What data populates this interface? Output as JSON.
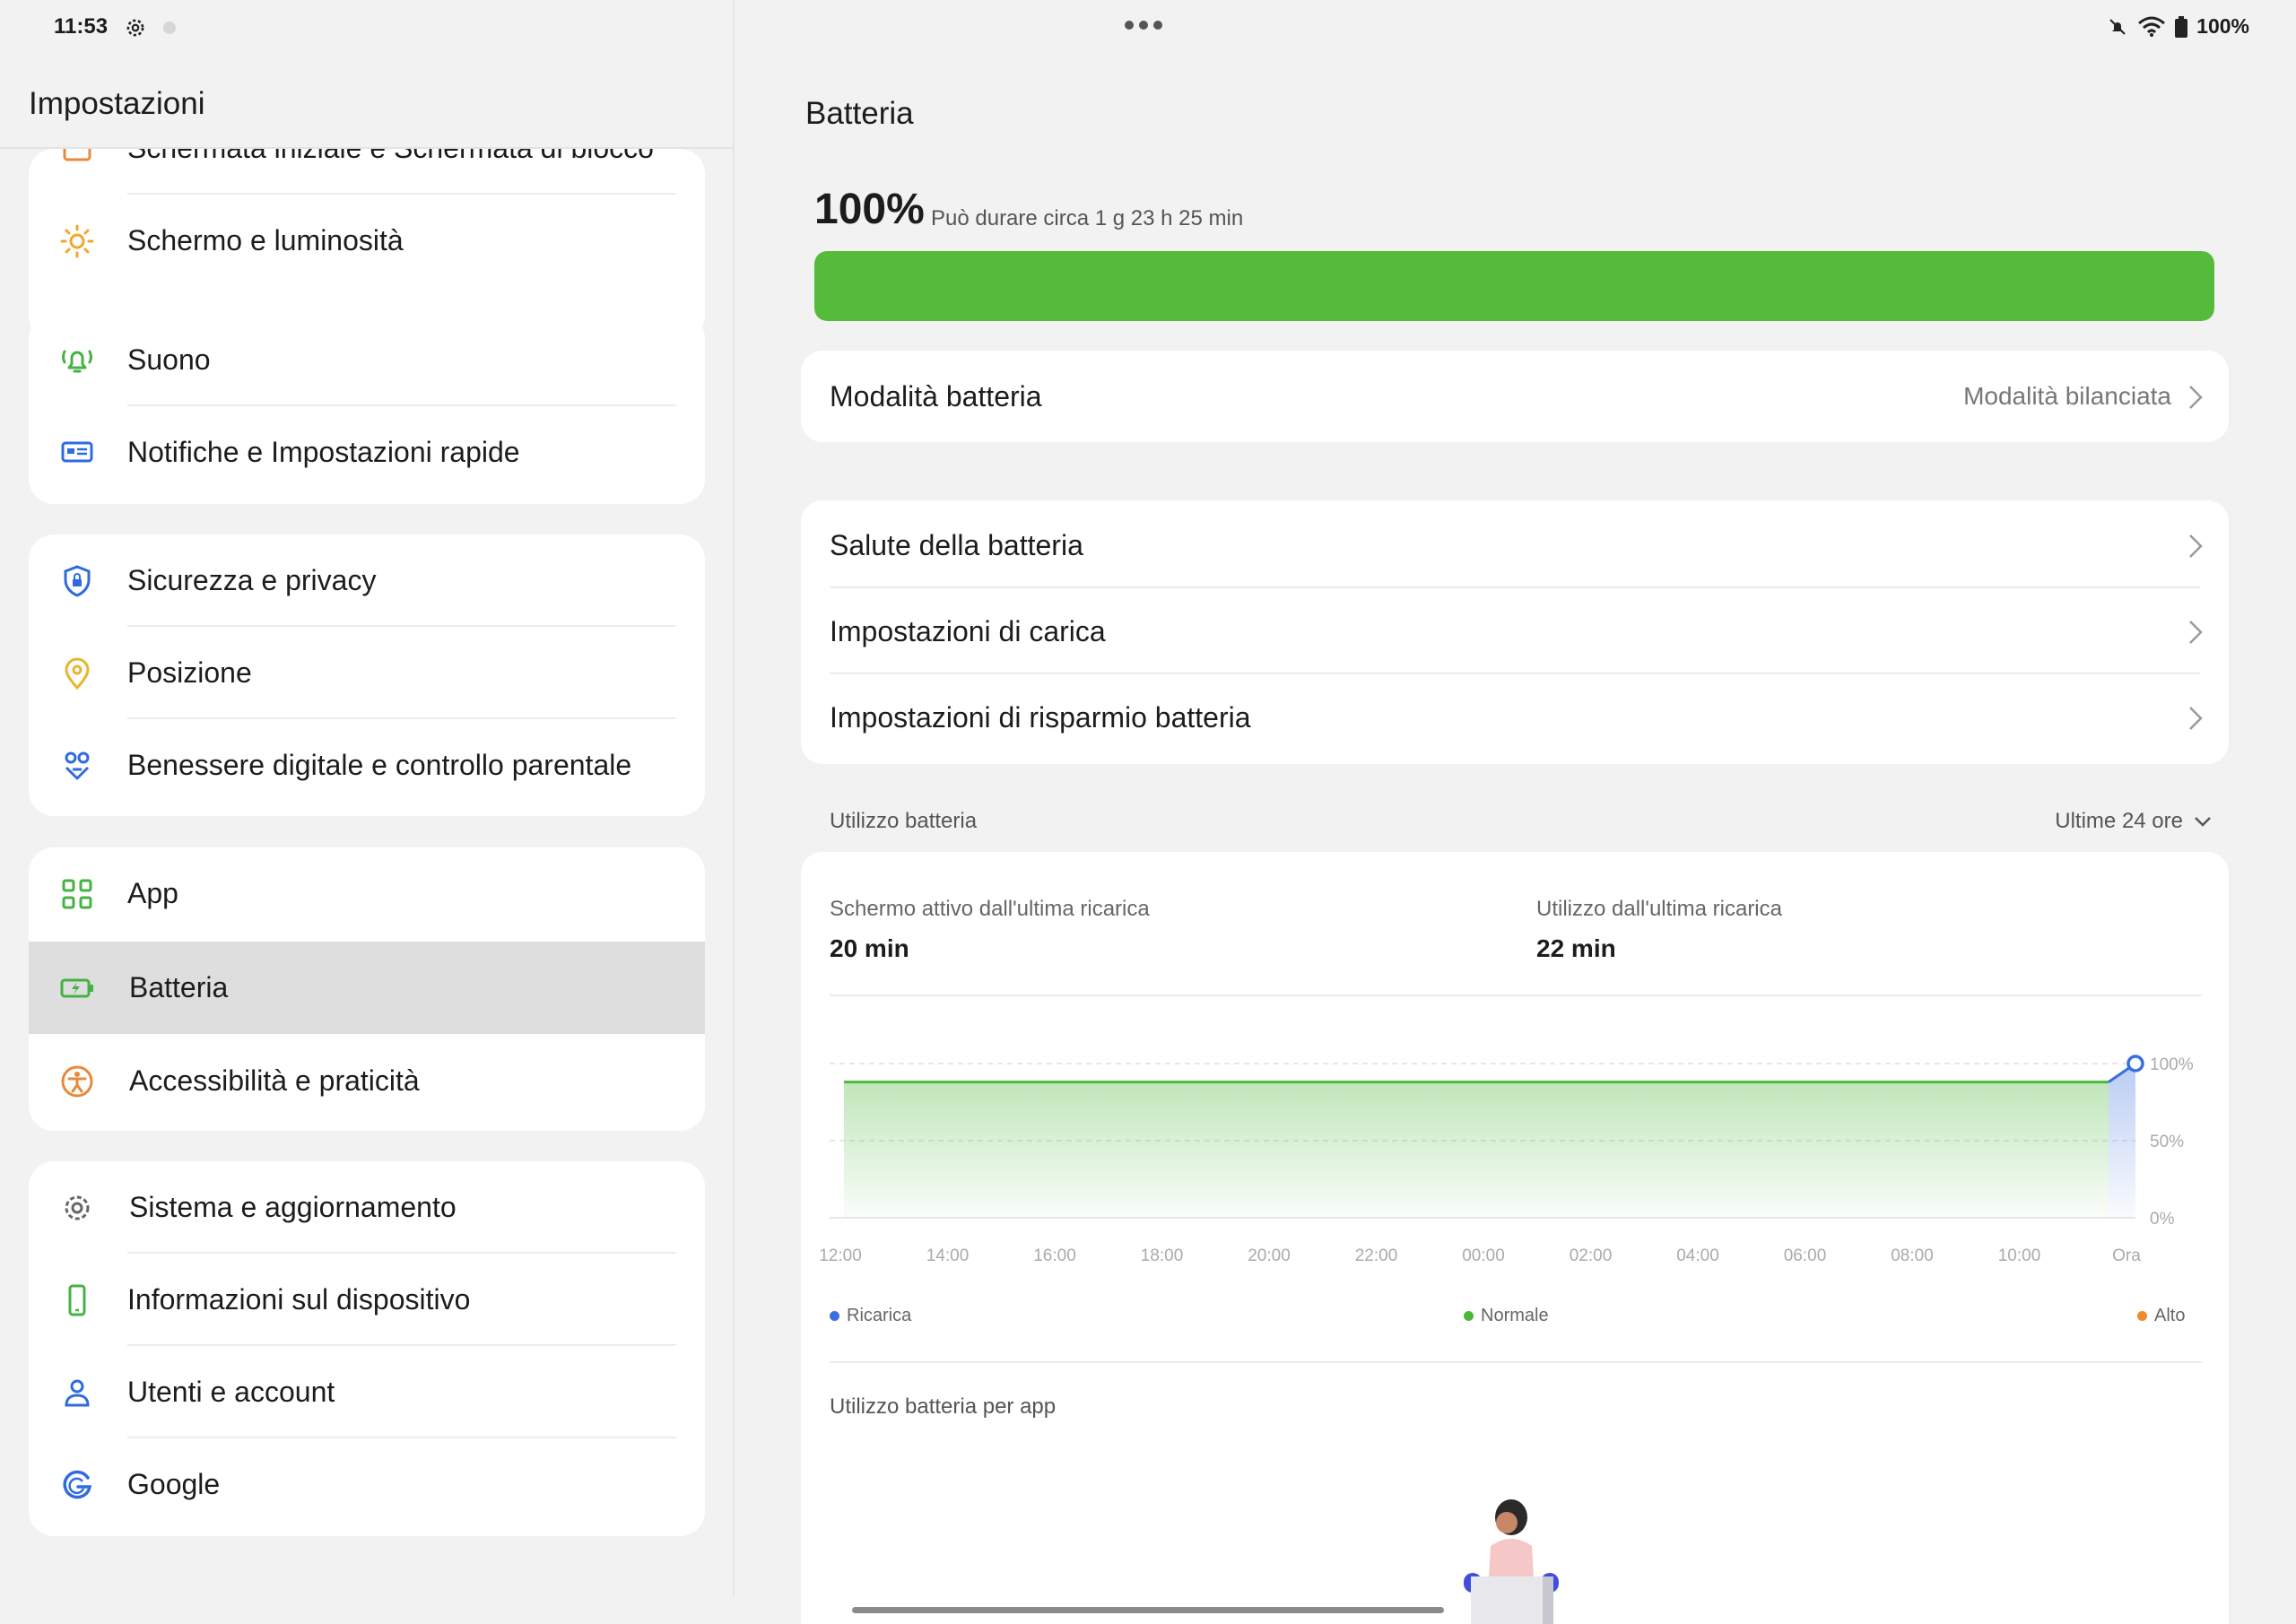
{
  "statusbar": {
    "time": "11:53",
    "battery_text": "100%"
  },
  "left": {
    "title": "Impostazioni",
    "groups": [
      {
        "items": [
          {
            "label": "Schermata iniziale e Schermata di blocco",
            "icon": "home-screen-icon"
          },
          {
            "label": "Schermo e luminosità",
            "icon": "brightness-icon"
          }
        ]
      },
      {
        "items": [
          {
            "label": "Suono",
            "icon": "bell-icon"
          },
          {
            "label": "Notifiche e Impostazioni rapide",
            "icon": "notifications-icon"
          }
        ]
      },
      {
        "items": [
          {
            "label": "Sicurezza e privacy",
            "icon": "shield-icon"
          },
          {
            "label": "Posizione",
            "icon": "location-icon"
          },
          {
            "label": "Benessere digitale e controllo parentale",
            "icon": "wellbeing-icon"
          }
        ]
      },
      {
        "items": [
          {
            "label": "App",
            "icon": "apps-icon"
          },
          {
            "label": "Batteria",
            "icon": "battery-icon",
            "active": true
          },
          {
            "label": "Accessibilità e praticità",
            "icon": "accessibility-icon"
          }
        ]
      },
      {
        "items": [
          {
            "label": "Sistema e aggiornamento",
            "icon": "gear-icon"
          },
          {
            "label": "Informazioni sul dispositivo",
            "icon": "phone-icon"
          },
          {
            "label": "Utenti e account",
            "icon": "user-icon"
          },
          {
            "label": "Google",
            "icon": "google-icon"
          }
        ]
      }
    ]
  },
  "right": {
    "title": "Batteria",
    "level_text": "100%",
    "level_fraction": 1.0,
    "estimate": "Può durare circa 1 g 23 h 25 min",
    "mode": {
      "label": "Modalità batteria",
      "value": "Modalità bilanciata"
    },
    "menu": [
      {
        "label": "Salute della batteria"
      },
      {
        "label": "Impostazioni di carica"
      },
      {
        "label": "Impostazioni di risparmio batteria"
      }
    ],
    "usage_label": "Utilizzo batteria",
    "usage_range": "Ultime 24 ore",
    "screen_on": {
      "title": "Schermo attivo dall'ultima ricarica",
      "value": "20 min"
    },
    "usage_since": {
      "title": "Utilizzo dall'ultima ricarica",
      "value": "22 min"
    },
    "legend": [
      {
        "label": "Ricarica",
        "color": "#3a6fe0"
      },
      {
        "label": "Normale",
        "color": "#4cb83a"
      },
      {
        "label": "Alto",
        "color": "#f08a2a"
      }
    ],
    "per_app_label": "Utilizzo batteria per app"
  },
  "chart_data": {
    "type": "area",
    "x": [
      "12:00",
      "14:00",
      "16:00",
      "18:00",
      "20:00",
      "22:00",
      "00:00",
      "02:00",
      "04:00",
      "06:00",
      "08:00",
      "10:00",
      "Ora"
    ],
    "yticks": [
      "100%",
      "50%",
      "0%"
    ],
    "ylim": [
      0,
      100
    ],
    "series": [
      {
        "name": "Normale",
        "values": [
          88,
          88,
          88,
          88,
          88,
          88,
          88,
          88,
          88,
          88,
          88,
          88
        ]
      },
      {
        "name": "Ricarica",
        "values": [
          88,
          100
        ]
      }
    ],
    "grid": true,
    "legend_position": "bottom"
  }
}
